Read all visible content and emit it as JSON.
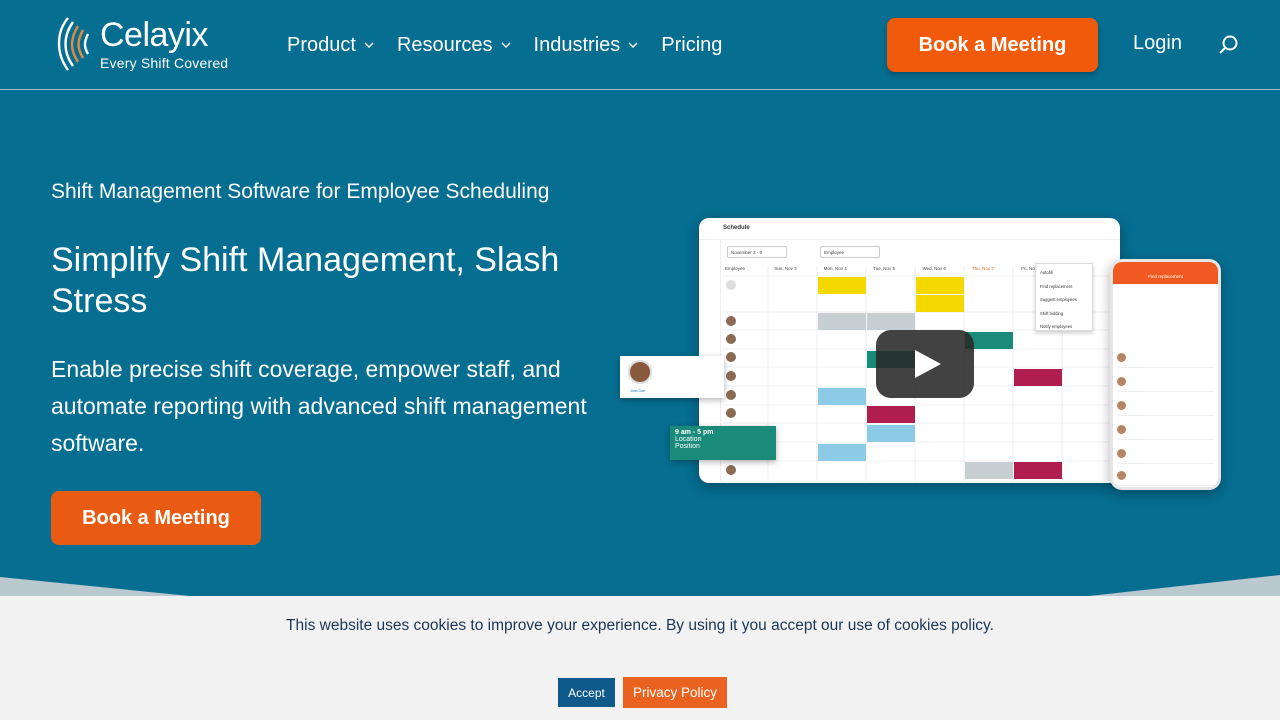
{
  "header": {
    "logo_name": "Celayix",
    "logo_tagline": "Every Shift Covered",
    "nav": [
      {
        "label": "Product",
        "has_dropdown": true
      },
      {
        "label": "Resources",
        "has_dropdown": true
      },
      {
        "label": "Industries",
        "has_dropdown": true
      },
      {
        "label": "Pricing",
        "has_dropdown": false
      }
    ],
    "book_label": "Book a Meeting",
    "login_label": "Login"
  },
  "hero": {
    "kicker": "Shift Management Software for Employee Scheduling",
    "title": "Simplify Shift Management, Slash Stress",
    "subtitle": "Enable precise shift coverage, empower staff, and automate reporting with advanced shift management software.",
    "cta_label": "Book a Meeting"
  },
  "mockup": {
    "app_title": "Schedule",
    "date_range": "November 3 - 9",
    "filter": "Employee",
    "columns": [
      "Employee",
      "Sun, Nov 3",
      "Mon, Nov 4",
      "Tue, Nov 5",
      "Wed, Nov 6",
      "Thu, Nov 7",
      "Fri, Nov 8",
      "Sat, Nov 9"
    ],
    "menu_items": [
      "Autofill",
      "Find replacement",
      "Suggest employees",
      "Shift bidding",
      "Notify employees"
    ],
    "shift_card_time": "9 am - 5 pm",
    "shift_card_location": "Location",
    "shift_card_position": "Position",
    "profile_name": "John Doe",
    "phone_title": "Find replacement"
  },
  "cookie": {
    "text": "This website uses cookies to improve your experience. By using it you accept our use of cookies policy.",
    "accept_label": "Accept",
    "privacy_label": "Privacy Policy"
  },
  "colors": {
    "hero_bg": "#066e91",
    "accent_orange": "#f15a0b",
    "cookie_bg": "#f2f2f2",
    "accept_blue": "#0e5a8a"
  }
}
